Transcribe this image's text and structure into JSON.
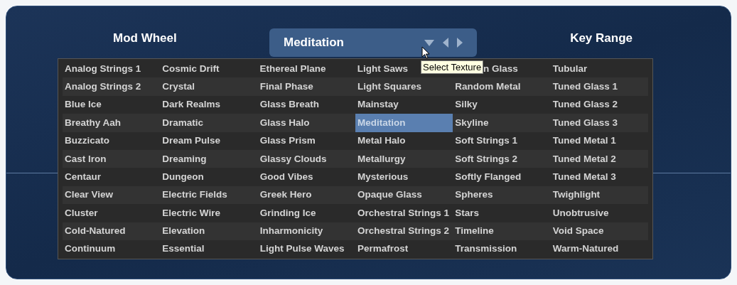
{
  "labels": {
    "mod_wheel": "Mod Wheel",
    "key_range": "Key Range"
  },
  "selector": {
    "value": "Meditation"
  },
  "tooltip": "Select Texture",
  "columns": [
    {
      "items": [
        {
          "label": "Analog Strings 1",
          "selected": false
        },
        {
          "label": "Analog Strings 2",
          "selected": false
        },
        {
          "label": "Blue Ice",
          "selected": false
        },
        {
          "label": "Breathy Aah",
          "selected": false
        },
        {
          "label": "Buzzicato",
          "selected": false
        },
        {
          "label": "Cast Iron",
          "selected": false
        },
        {
          "label": "Centaur",
          "selected": false
        },
        {
          "label": "Clear View",
          "selected": false
        },
        {
          "label": "Cluster",
          "selected": false
        },
        {
          "label": "Cold-Natured",
          "selected": false
        },
        {
          "label": "Continuum",
          "selected": false
        }
      ]
    },
    {
      "items": [
        {
          "label": "Cosmic Drift",
          "selected": false
        },
        {
          "label": "Crystal",
          "selected": false
        },
        {
          "label": "Dark Realms",
          "selected": false
        },
        {
          "label": "Dramatic",
          "selected": false
        },
        {
          "label": "Dream Pulse",
          "selected": false
        },
        {
          "label": "Dreaming",
          "selected": false
        },
        {
          "label": "Dungeon",
          "selected": false
        },
        {
          "label": "Electric Fields",
          "selected": false
        },
        {
          "label": "Electric Wire",
          "selected": false
        },
        {
          "label": "Elevation",
          "selected": false
        },
        {
          "label": "Essential",
          "selected": false
        }
      ]
    },
    {
      "items": [
        {
          "label": "Ethereal Plane",
          "selected": false
        },
        {
          "label": "Final Phase",
          "selected": false
        },
        {
          "label": "Glass Breath",
          "selected": false
        },
        {
          "label": "Glass Halo",
          "selected": false
        },
        {
          "label": "Glass Prism",
          "selected": false
        },
        {
          "label": "Glassy Clouds",
          "selected": false
        },
        {
          "label": "Good Vibes",
          "selected": false
        },
        {
          "label": "Greek Hero",
          "selected": false
        },
        {
          "label": "Grinding Ice",
          "selected": false
        },
        {
          "label": "Inharmonicity",
          "selected": false
        },
        {
          "label": "Light Pulse Waves",
          "selected": false
        }
      ]
    },
    {
      "items": [
        {
          "label": "Light Saws",
          "selected": false
        },
        {
          "label": "Light Squares",
          "selected": false
        },
        {
          "label": "Mainstay",
          "selected": false
        },
        {
          "label": "Meditation",
          "selected": true
        },
        {
          "label": "Metal Halo",
          "selected": false
        },
        {
          "label": "Metallurgy",
          "selected": false
        },
        {
          "label": "Mysterious",
          "selected": false
        },
        {
          "label": "Opaque Glass",
          "selected": false
        },
        {
          "label": "Orchestral Strings 1",
          "selected": false
        },
        {
          "label": "Orchestral Strings 2",
          "selected": false
        },
        {
          "label": "Permafrost",
          "selected": false
        }
      ]
    },
    {
      "items": [
        {
          "label": "n Glass",
          "selected": false,
          "kind": "covered"
        },
        {
          "label": "Random Metal",
          "selected": false
        },
        {
          "label": "Silky",
          "selected": false
        },
        {
          "label": "Skyline",
          "selected": false
        },
        {
          "label": "Soft Strings 1",
          "selected": false
        },
        {
          "label": "Soft Strings 2",
          "selected": false
        },
        {
          "label": "Softly Flanged",
          "selected": false
        },
        {
          "label": "Spheres",
          "selected": false
        },
        {
          "label": "Stars",
          "selected": false
        },
        {
          "label": "Timeline",
          "selected": false
        },
        {
          "label": "Transmission",
          "selected": false
        }
      ]
    },
    {
      "items": [
        {
          "label": "Tubular",
          "selected": false
        },
        {
          "label": "Tuned Glass 1",
          "selected": false
        },
        {
          "label": "Tuned Glass 2",
          "selected": false
        },
        {
          "label": "Tuned Glass 3",
          "selected": false
        },
        {
          "label": "Tuned Metal 1",
          "selected": false
        },
        {
          "label": "Tuned Metal 2",
          "selected": false
        },
        {
          "label": "Tuned Metal 3",
          "selected": false
        },
        {
          "label": "Twighlight",
          "selected": false
        },
        {
          "label": "Unobtrusive",
          "selected": false
        },
        {
          "label": "Void Space",
          "selected": false
        },
        {
          "label": "Warm-Natured",
          "selected": false
        }
      ]
    }
  ]
}
